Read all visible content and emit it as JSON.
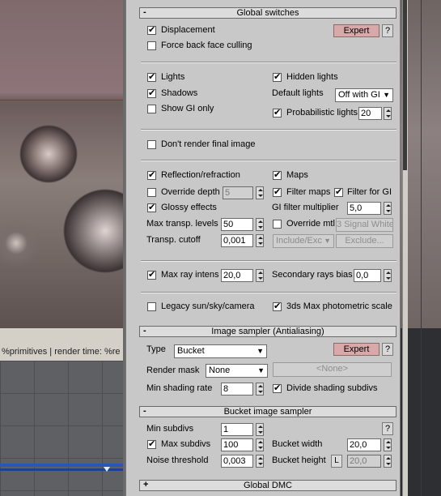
{
  "viewport": {
    "status_text": "%primitives | render time: %re"
  },
  "global_switches": {
    "title": "Global switches",
    "sign": "-",
    "displacement": {
      "label": "Displacement",
      "checked": true
    },
    "force_back_face_culling": {
      "label": "Force back face culling",
      "checked": false
    },
    "expert_label": "Expert",
    "help_label": "?",
    "lights": {
      "label": "Lights",
      "checked": true
    },
    "hidden_lights": {
      "label": "Hidden lights",
      "checked": true
    },
    "shadows": {
      "label": "Shadows",
      "checked": true
    },
    "default_lights": {
      "label": "Default lights",
      "value": "Off with GI"
    },
    "show_gi_only": {
      "label": "Show GI only",
      "checked": false
    },
    "probabilistic_lights": {
      "label": "Probabilistic lights",
      "checked": true,
      "value": "20"
    },
    "dont_render_final": {
      "label": "Don't render final image",
      "checked": false
    },
    "reflection_refraction": {
      "label": "Reflection/refraction",
      "checked": true
    },
    "maps": {
      "label": "Maps",
      "checked": true
    },
    "override_depth": {
      "label": "Override depth",
      "checked": false,
      "value": "5"
    },
    "filter_maps": {
      "label": "Filter maps",
      "checked": true
    },
    "filter_for_gi": {
      "label": "Filter for GI",
      "checked": true
    },
    "glossy_effects": {
      "label": "Glossy effects",
      "checked": true
    },
    "gi_filter_multiplier": {
      "label": "GI filter multiplier",
      "value": "5,0"
    },
    "max_transp_levels": {
      "label": "Max transp. levels",
      "value": "50"
    },
    "override_mtl": {
      "label": "Override mtl",
      "checked": false,
      "button": "3 Signal White"
    },
    "transp_cutoff": {
      "label": "Transp. cutoff",
      "value": "0,001"
    },
    "include_exclude": {
      "value": "Include/Exc"
    },
    "exclude_button": "Exclude...",
    "max_ray_intens": {
      "label": "Max ray intens",
      "checked": true,
      "value": "20,0"
    },
    "secondary_rays_bias": {
      "label": "Secondary rays bias",
      "value": "0,0"
    },
    "legacy_sun": {
      "label": "Legacy sun/sky/camera",
      "checked": false
    },
    "photometric_scale": {
      "label": "3ds Max photometric scale",
      "checked": true
    }
  },
  "image_sampler": {
    "title": "Image sampler (Antialiasing)",
    "sign": "-",
    "type_label": "Type",
    "type_value": "Bucket",
    "render_mask_label": "Render mask",
    "render_mask_value": "None",
    "none_button": "<None>",
    "min_shading_rate": {
      "label": "Min shading rate",
      "value": "8"
    },
    "divide_shading_subdivs": {
      "label": "Divide shading subdivs",
      "checked": true
    },
    "expert_label": "Expert",
    "help_label": "?"
  },
  "bucket_sampler": {
    "title": "Bucket image sampler",
    "sign": "-",
    "min_subdivs": {
      "label": "Min subdivs",
      "value": "1"
    },
    "max_subdivs": {
      "label": "Max subdivs",
      "checked": true,
      "value": "100"
    },
    "bucket_width": {
      "label": "Bucket width",
      "value": "20,0"
    },
    "noise_threshold": {
      "label": "Noise threshold",
      "value": "0,003"
    },
    "bucket_height": {
      "label": "Bucket height",
      "lock": "L",
      "value": "20,0"
    },
    "help_label": "?"
  },
  "global_dmc": {
    "title": "Global DMC",
    "sign": "+"
  },
  "colors": {
    "panel": "#c8c8c8",
    "expert_button": "#d9a8a8",
    "timeline_bar": "#2c55b8"
  }
}
